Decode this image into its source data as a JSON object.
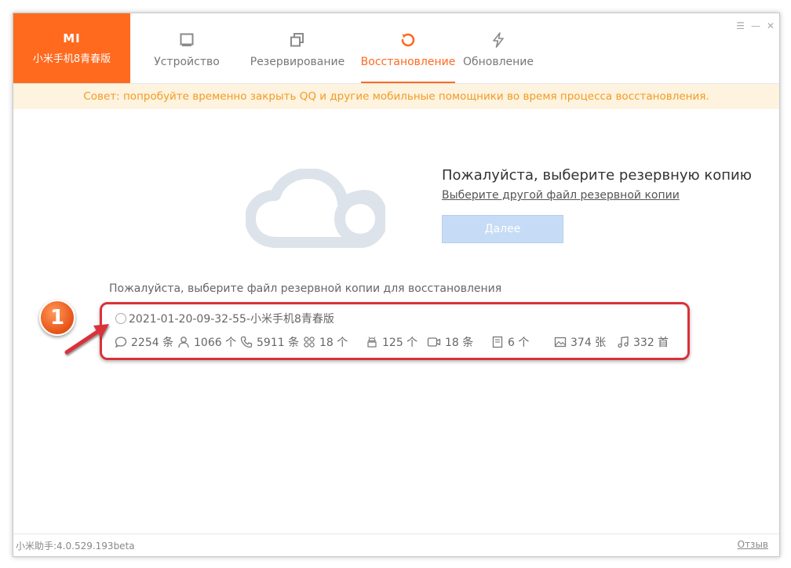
{
  "brand": {
    "logo": "MI",
    "model": "小米手机8青春版"
  },
  "nav": {
    "tabs": [
      {
        "label": "Устройство",
        "icon": "device-icon"
      },
      {
        "label": "Резервирование",
        "icon": "backup-icon"
      },
      {
        "label": "Восстановление",
        "icon": "restore-icon",
        "active": true
      },
      {
        "label": "Обновление",
        "icon": "update-icon"
      }
    ]
  },
  "tip": "Совет: попробуйте временно закрыть QQ и другие мобильные помощники во время процесса восстановления.",
  "main": {
    "headline": "Пожалуйста, выберите резервную копию",
    "other_file_link": "Выберите другой файл резервной копии",
    "next_button": "Далее",
    "choose_label": "Пожалуйста, выберите файл резервной копии для восстановления"
  },
  "backup": {
    "name": "2021-01-20-09-32-55-小米手机8青春版",
    "stats": {
      "messages": "2254 条",
      "contacts": "1066 个",
      "calls": "5911 条",
      "apps": "18 个",
      "system": "125 个",
      "videos": "18 条",
      "notes": "6 个",
      "photos": "374 张",
      "music": "332 首"
    }
  },
  "annotation": {
    "step": "1"
  },
  "footer": {
    "version": "小米助手:4.0.529.193beta",
    "feedback": "Отзыв"
  },
  "colors": {
    "accent": "#ff6a1f",
    "tip_text": "#f29b24",
    "tip_bg": "#fdf3df",
    "highlight": "#d9323a",
    "button_disabled": "#c6dcf6"
  }
}
